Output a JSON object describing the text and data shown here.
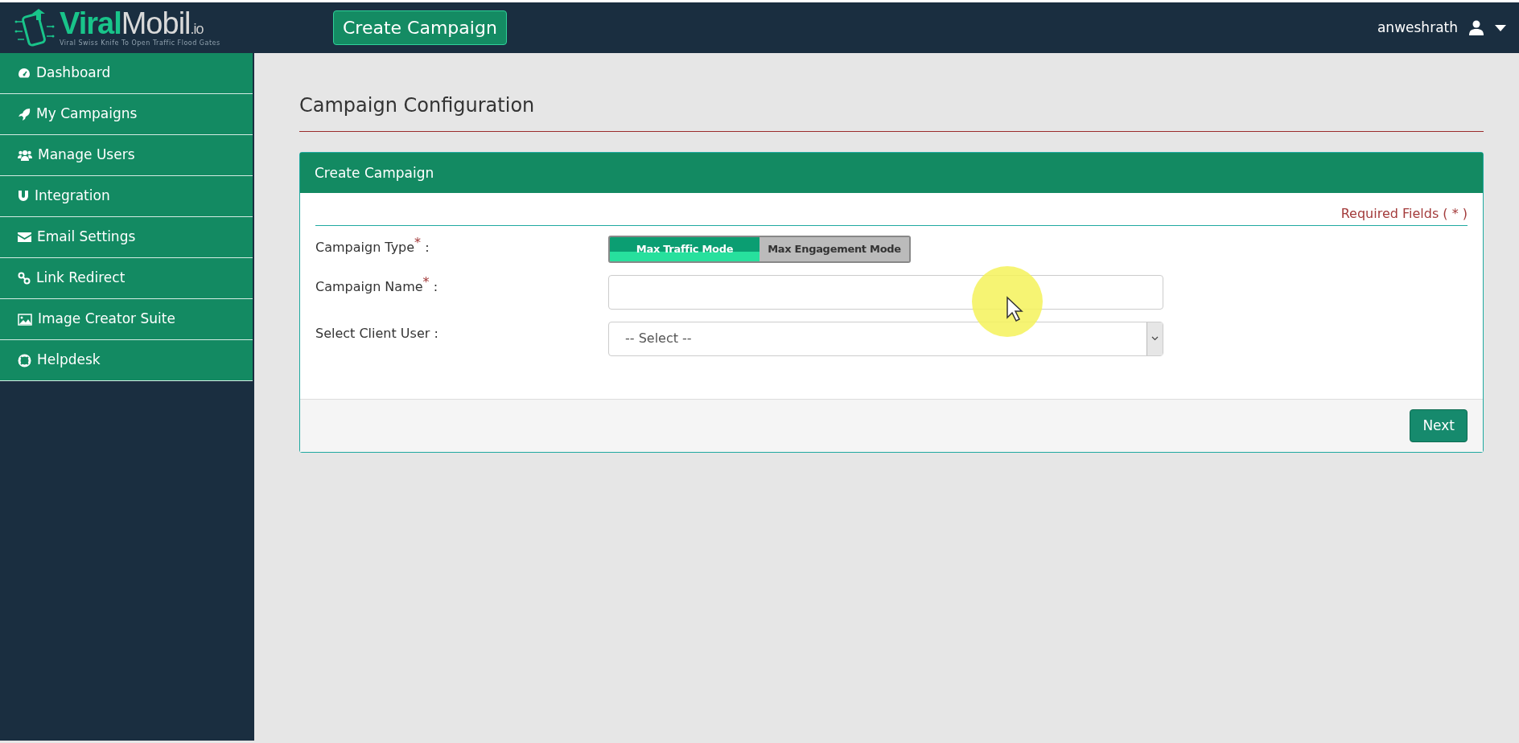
{
  "header": {
    "logo": {
      "primary": "Viral",
      "secondary": "Mobil",
      "suffix": ".io",
      "tagline": "Viral Swiss Knife To Open Traffic Flood Gates"
    },
    "action_button": "Create Campaign",
    "username": "anweshrath"
  },
  "sidebar": {
    "items": [
      {
        "label": "Dashboard"
      },
      {
        "label": "My Campaigns"
      },
      {
        "label": "Manage Users"
      },
      {
        "label": "Integration"
      },
      {
        "label": "Email Settings"
      },
      {
        "label": "Link Redirect"
      },
      {
        "label": "Image Creator Suite"
      },
      {
        "label": "Helpdesk"
      }
    ]
  },
  "page_title": "Campaign Configuration",
  "form": {
    "title": "Create Campaign",
    "required_note": "Required Fields ( * )",
    "fields": [
      {
        "kind": "toggle",
        "label": "Campaign Type",
        "required_mark": "*",
        "colon": ":",
        "options": [
          {
            "label": "Max Traffic Mode",
            "selected": true
          },
          {
            "label": "Max Engagement Mode",
            "selected": false
          }
        ]
      },
      {
        "kind": "text",
        "label": "Campaign Name",
        "required_mark": "*",
        "colon": ":"
      },
      {
        "kind": "select",
        "label": "Select Client User",
        "colon": ":",
        "value": "-- Select --"
      }
    ],
    "submit": "Next"
  }
}
